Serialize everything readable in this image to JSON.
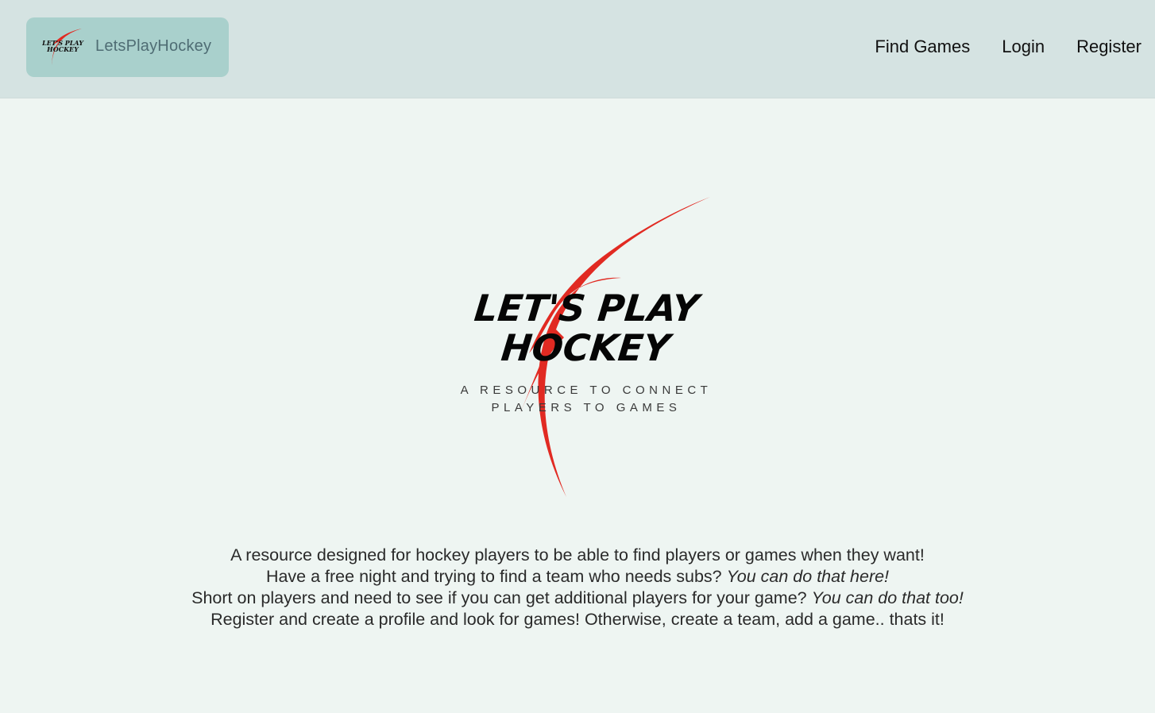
{
  "header": {
    "brand_label": "LetsPlayHockey",
    "brand_logo_line1": "LET'S PLAY",
    "brand_logo_line2": "HOCKEY",
    "nav": [
      {
        "label": "Find Games"
      },
      {
        "label": "Login"
      },
      {
        "label": "Register"
      }
    ]
  },
  "hero": {
    "logo_line1": "LET'S PLAY",
    "logo_line2": "HOCKEY",
    "tagline_line1": "A RESOURCE TO CONNECT",
    "tagline_line2": "PLAYERS TO GAMES",
    "accent_color": "#e12a22"
  },
  "description": {
    "line1": "A resource designed for hockey players to be able to find players or games when they want!",
    "line2_plain": "Have a free night and trying to find a team who needs subs?",
    "line2_italic": "You can do that here!",
    "line3_plain": "Short on players and need to see if you can get additional players for your game?",
    "line3_italic": "You can do that too!",
    "line4": "Register and create a profile and look for games! Otherwise, create a team, add a game.. thats it!"
  }
}
